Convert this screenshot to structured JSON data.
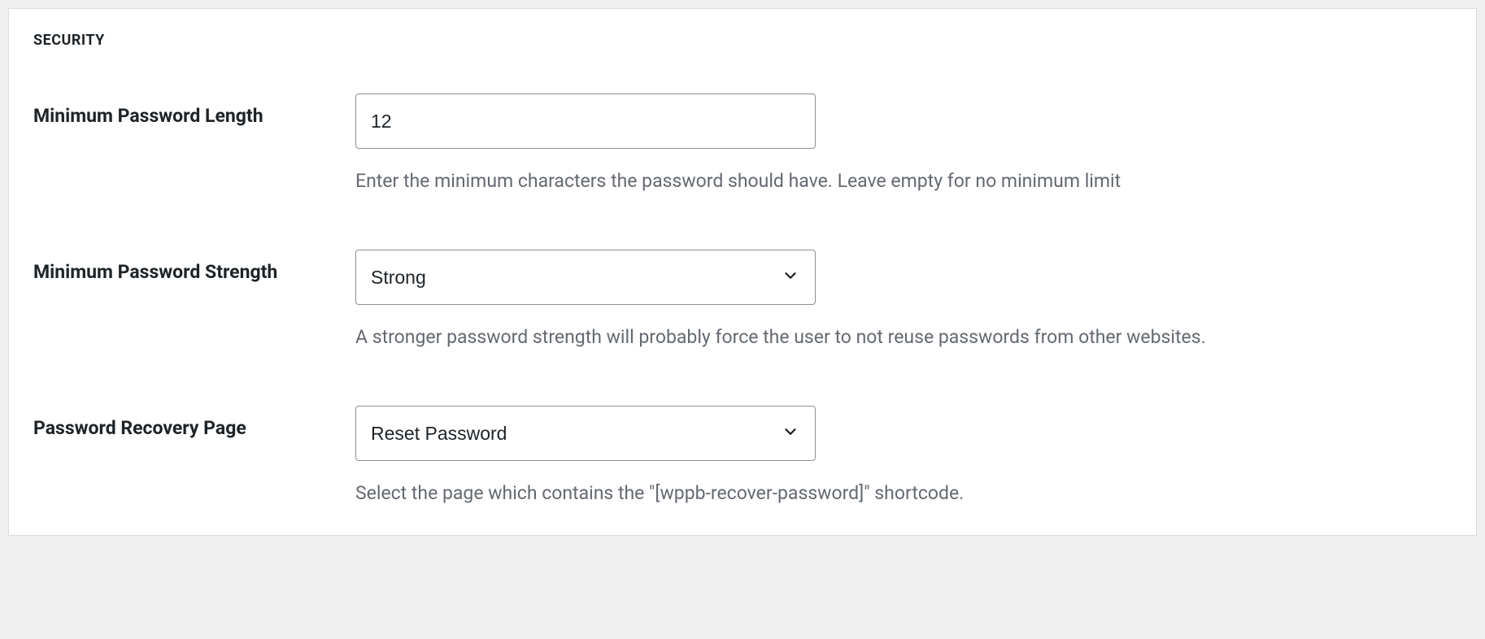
{
  "section": {
    "title": "SECURITY"
  },
  "fields": {
    "min_password_length": {
      "label": "Minimum Password Length",
      "value": "12",
      "description": "Enter the minimum characters the password should have. Leave empty for no minimum limit"
    },
    "min_password_strength": {
      "label": "Minimum Password Strength",
      "value": "Strong",
      "description": "A stronger password strength will probably force the user to not reuse passwords from other websites."
    },
    "password_recovery_page": {
      "label": "Password Recovery Page",
      "value": "Reset Password",
      "description": "Select the page which contains the \"[wppb-recover-password]\" shortcode."
    }
  }
}
